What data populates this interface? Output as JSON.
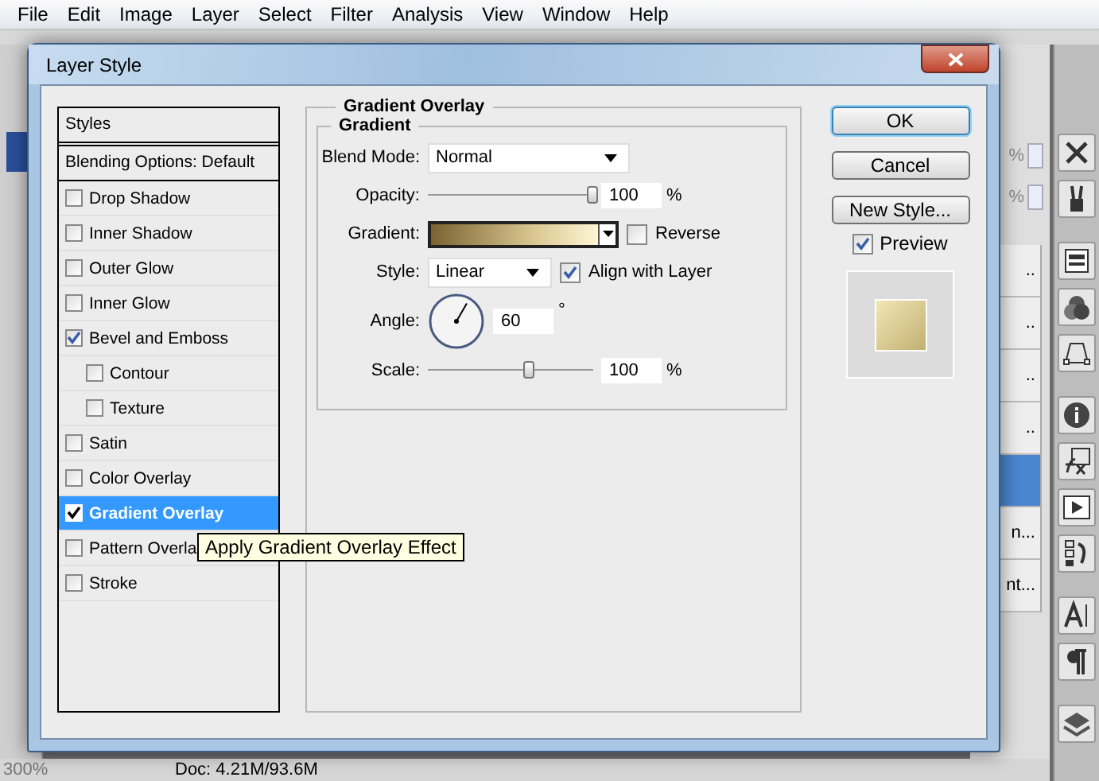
{
  "menu_bar": [
    "File",
    "Edit",
    "Image",
    "Layer",
    "Select",
    "Filter",
    "Analysis",
    "View",
    "Window",
    "Help"
  ],
  "dialog": {
    "title": "Layer Style"
  },
  "styles_panel": {
    "header": "Styles",
    "blending": "Blending Options: Default",
    "items": [
      {
        "label": "Drop Shadow",
        "checked": false,
        "selected": false
      },
      {
        "label": "Inner Shadow",
        "checked": false,
        "selected": false
      },
      {
        "label": "Outer Glow",
        "checked": false,
        "selected": false
      },
      {
        "label": "Inner Glow",
        "checked": false,
        "selected": false
      },
      {
        "label": "Bevel and Emboss",
        "checked": true,
        "selected": false,
        "children": [
          {
            "label": "Contour",
            "checked": false,
            "selected": false
          },
          {
            "label": "Texture",
            "checked": false,
            "selected": false
          }
        ]
      },
      {
        "label": "Satin",
        "checked": false,
        "selected": false
      },
      {
        "label": "Color Overlay",
        "checked": false,
        "selected": false
      },
      {
        "label": "Gradient Overlay",
        "checked": true,
        "selected": true
      },
      {
        "label": "Pattern Overla",
        "checked": false,
        "selected": false
      },
      {
        "label": "Stroke",
        "checked": false,
        "selected": false
      }
    ]
  },
  "tooltip": "Apply Gradient Overlay Effect",
  "gradient_overlay": {
    "title": "Gradient Overlay",
    "section": "Gradient",
    "blend_mode": {
      "label": "Blend Mode:",
      "value": "Normal"
    },
    "opacity": {
      "label": "Opacity:",
      "level": 1,
      "value": "100",
      "unit": "%"
    },
    "gradient": {
      "label": "Gradient:",
      "reverse": {
        "label": "Reverse",
        "checked": false
      }
    },
    "style": {
      "label": "Style:",
      "value": "Linear",
      "align": {
        "label": "Align with Layer",
        "checked": true
      }
    },
    "angle": {
      "label": "Angle:",
      "value": "60",
      "unit": "°"
    },
    "scale": {
      "label": "Scale:",
      "level": 0.62,
      "value": "100",
      "unit": "%"
    }
  },
  "buttons": [
    {
      "label": "OK",
      "default": true
    },
    {
      "label": "Cancel",
      "default": false
    },
    {
      "label": "New Style...",
      "default": false
    }
  ],
  "preview": {
    "label": "Preview",
    "checked": true
  },
  "background_panel": {
    "percent_fields": [
      "%",
      "%"
    ],
    "rows": [
      {
        "text": "..",
        "selected": false
      },
      {
        "text": "..",
        "selected": false
      },
      {
        "text": "..",
        "selected": false
      },
      {
        "text": "..",
        "selected": false
      },
      {
        "selected": true
      },
      {
        "text": "n...",
        "selected": false
      },
      {
        "text": "nt...",
        "selected": false
      }
    ]
  },
  "dock": [
    {
      "kind": "tools"
    },
    {
      "kind": "brushes"
    },
    {
      "kind": "document"
    },
    {
      "kind": "circles"
    },
    {
      "kind": "path"
    },
    {
      "kind": "info"
    },
    {
      "kind": "fx"
    },
    {
      "kind": "play"
    },
    {
      "kind": "history"
    },
    {
      "kind": "letter"
    },
    {
      "kind": "paragraph"
    },
    {
      "kind": "layers"
    }
  ],
  "status_bar": {
    "zoom": "300%",
    "doc": "Doc: 4.21M/93.6M"
  }
}
